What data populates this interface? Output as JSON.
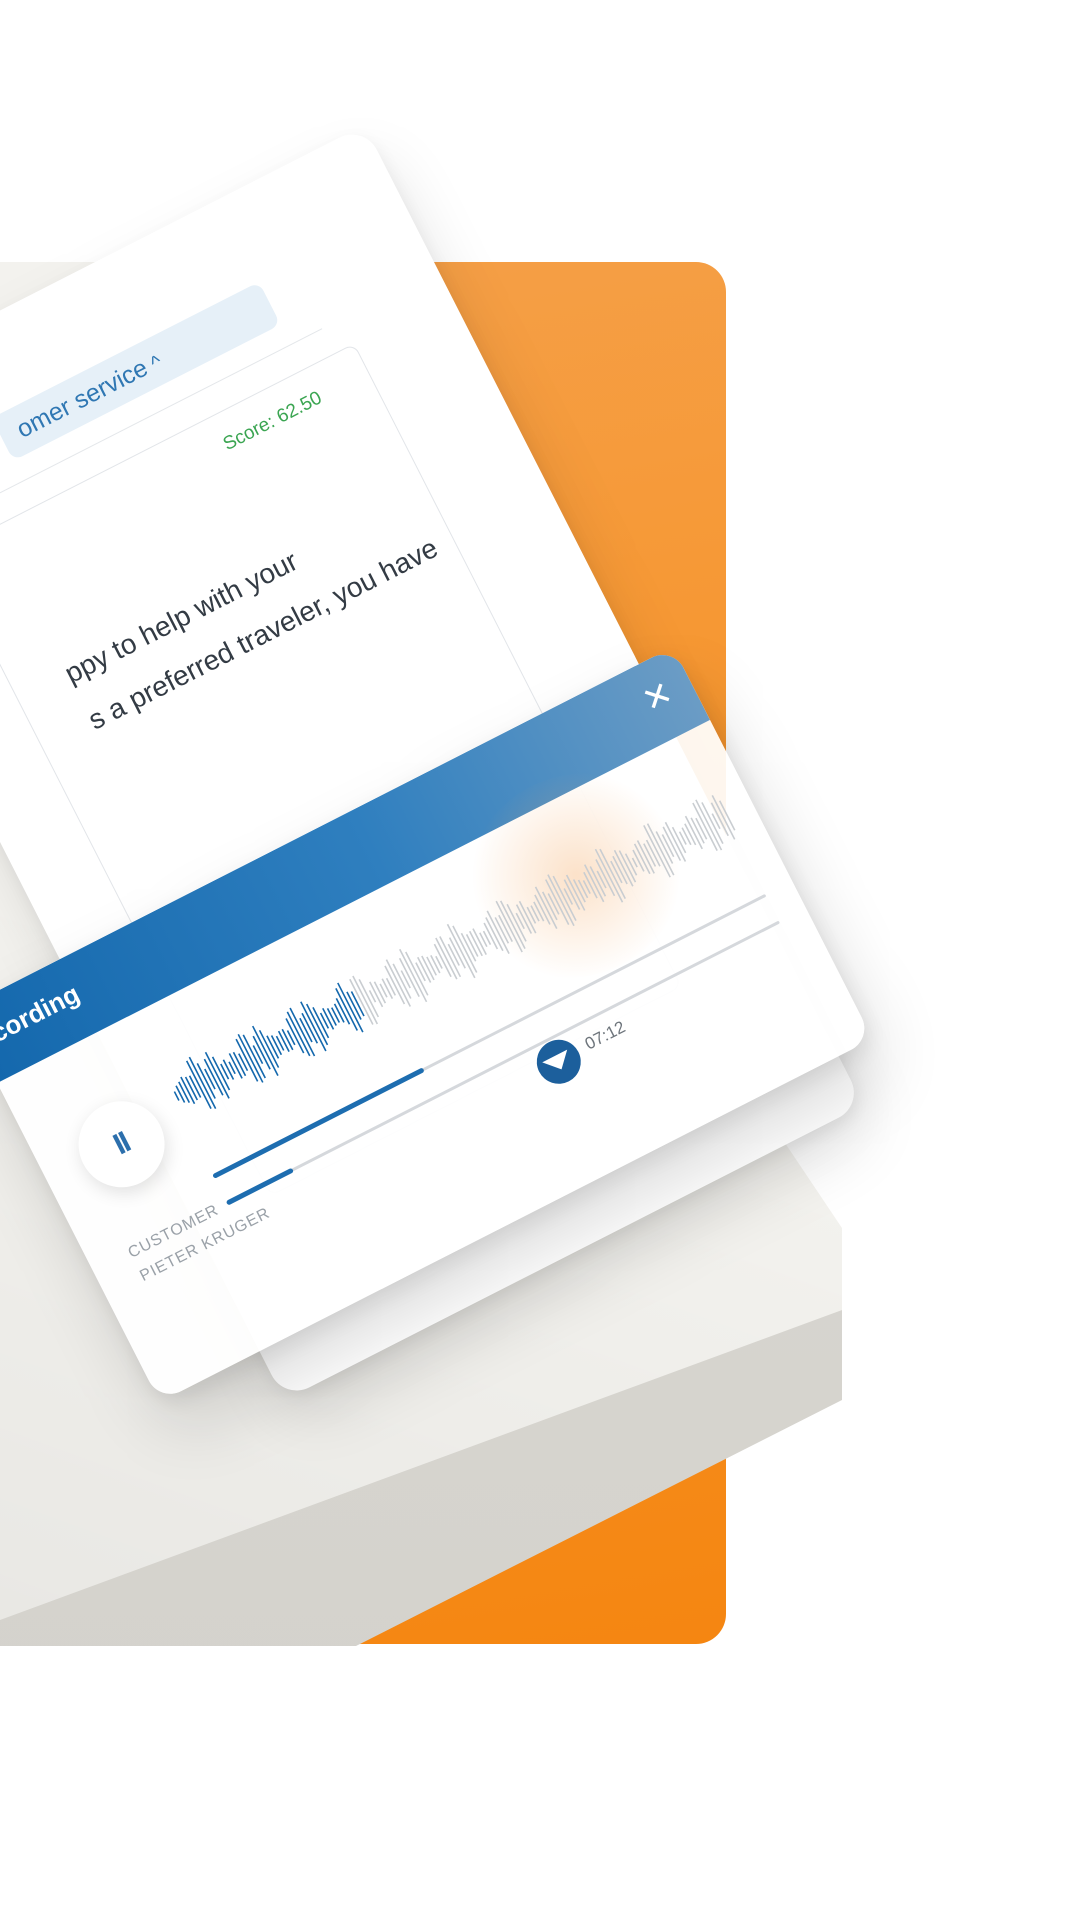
{
  "colors": {
    "accent_orange": "#f6962f",
    "accent_blue": "#1468ad",
    "score_green": "#3ba552",
    "stage": "#f3f2ee"
  },
  "card": {
    "department_label": "omer service",
    "department_chevron": "^",
    "score": "Score: 62.50",
    "transcript_lines": [
      "ppy to help with your",
      "s a preferred traveler, you have"
    ]
  },
  "player": {
    "title": "o recording",
    "close_icon": "close-icon",
    "pause_icon": "pause-icon",
    "play_icon": "play-icon",
    "speaker_role": "CUSTOMER",
    "speaker_name": "PIETER KRUGER",
    "duration": "07:12",
    "progress_main": 0.38,
    "progress_secondary": 0.12,
    "waveform_played_fraction": 0.33
  }
}
